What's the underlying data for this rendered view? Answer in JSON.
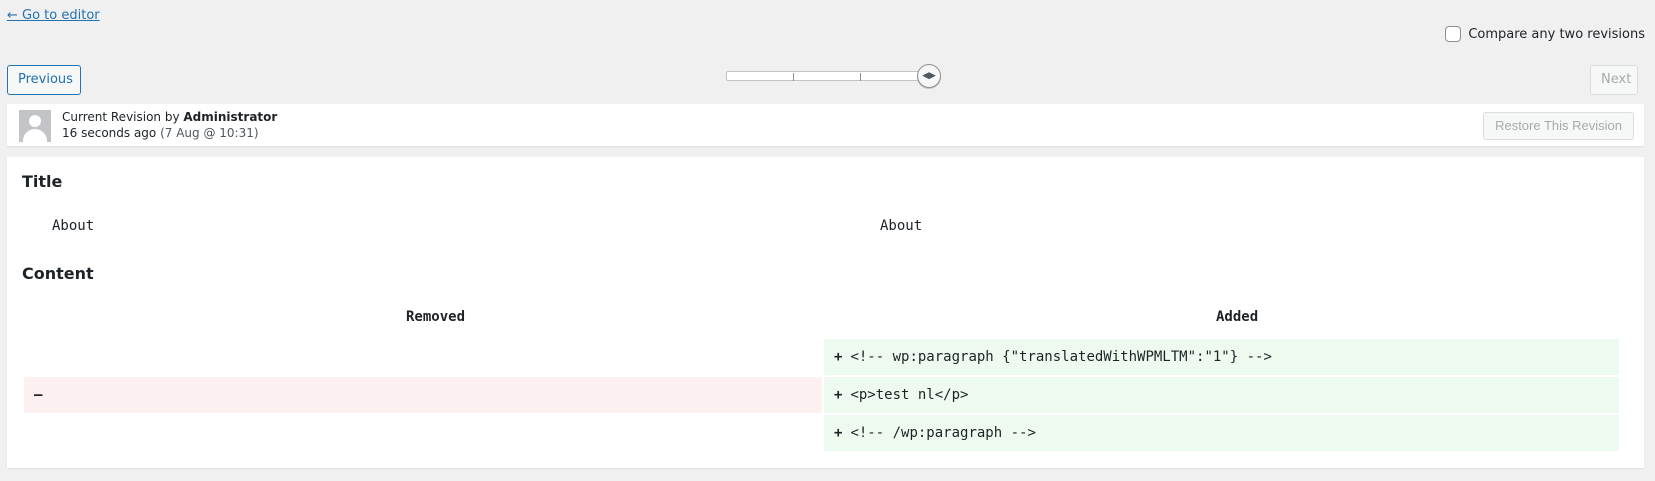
{
  "nav": {
    "back_link": "← Go to editor",
    "compare_label": "Compare any two revisions",
    "previous_label": "Previous",
    "next_label": "Next"
  },
  "revision": {
    "label_prefix": "Current Revision by ",
    "author": "Administrator",
    "time_ago": "16 seconds ago",
    "timestamp": "(7 Aug @ 10:31)",
    "restore_label": "Restore This Revision"
  },
  "diff": {
    "title_section": "Title",
    "title_left": "About",
    "title_right": "About",
    "content_section": "Content",
    "removed_header": "Removed",
    "added_header": "Added",
    "rows": [
      {
        "removed": "",
        "added": "<!-- wp:paragraph {\"translatedWithWPMLTM\":\"1\"} -->"
      },
      {
        "removed": "",
        "added": "<p>test nl</p>"
      },
      {
        "removed": "",
        "added": "<!-- /wp:paragraph -->"
      }
    ],
    "added_sign": "+",
    "removed_sign": "–"
  },
  "colors": {
    "link": "#2271b1",
    "added_bg": "#edfaef",
    "removed_bg": "#fcf0f1",
    "page_bg": "#f0f0f1"
  }
}
